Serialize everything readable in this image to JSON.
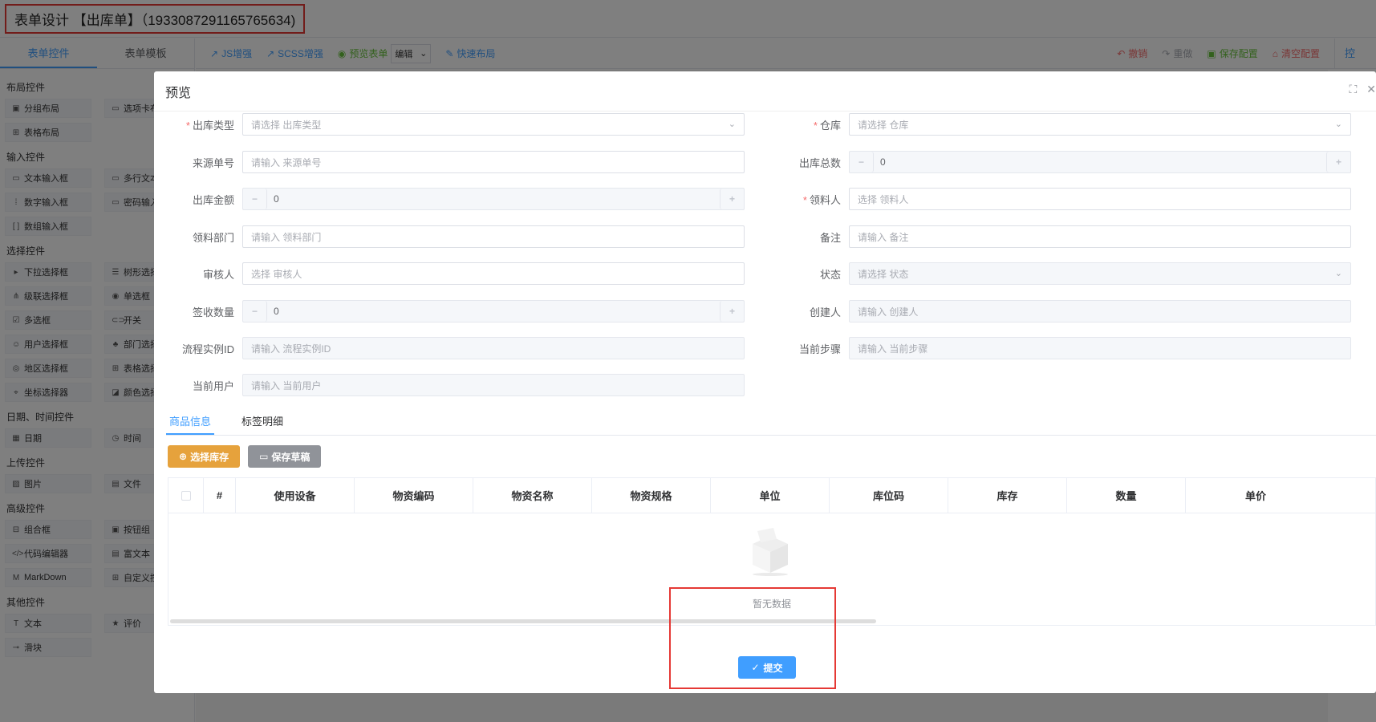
{
  "app": {
    "title": "表单设计 【出库单】（1933087291165765634)"
  },
  "left_panel": {
    "tabs": [
      "表单控件",
      "表单模板"
    ],
    "groups": [
      {
        "title": "布局控件",
        "items": [
          {
            "icon": "▣",
            "label": "分组布局"
          },
          {
            "icon": "▭",
            "label": "选项卡布"
          },
          {
            "icon": "⊞",
            "label": "表格布局"
          }
        ]
      },
      {
        "title": "输入控件",
        "items": [
          {
            "icon": "▭",
            "label": "文本输入框"
          },
          {
            "icon": "▭",
            "label": "多行文本"
          },
          {
            "icon": "⁞",
            "label": "数字输入框"
          },
          {
            "icon": "▭",
            "label": "密码输入"
          },
          {
            "icon": "[ ]",
            "label": "数组输入框"
          }
        ]
      },
      {
        "title": "选择控件",
        "items": [
          {
            "icon": "▸",
            "label": "下拉选择框"
          },
          {
            "icon": "☰",
            "label": "树形选择"
          },
          {
            "icon": "⋔",
            "label": "级联选择框"
          },
          {
            "icon": "◉",
            "label": "单选框"
          },
          {
            "icon": "☑",
            "label": "多选框"
          },
          {
            "icon": "⊂⊃",
            "label": "开关"
          },
          {
            "icon": "☺",
            "label": "用户选择框"
          },
          {
            "icon": "♣",
            "label": "部门选择"
          },
          {
            "icon": "◎",
            "label": "地区选择框"
          },
          {
            "icon": "⊞",
            "label": "表格选择"
          },
          {
            "icon": "⌖",
            "label": "坐标选择器"
          },
          {
            "icon": "◪",
            "label": "颜色选择"
          }
        ]
      },
      {
        "title": "日期、时间控件",
        "items": [
          {
            "icon": "▦",
            "label": "日期"
          },
          {
            "icon": "◷",
            "label": "时间"
          }
        ]
      },
      {
        "title": "上传控件",
        "items": [
          {
            "icon": "▨",
            "label": "图片"
          },
          {
            "icon": "▤",
            "label": "文件"
          }
        ]
      },
      {
        "title": "高级控件",
        "items": [
          {
            "icon": "⊟",
            "label": "组合框"
          },
          {
            "icon": "▣",
            "label": "按钮组"
          },
          {
            "icon": "</>",
            "label": "代码编辑器"
          },
          {
            "icon": "▤",
            "label": "富文本"
          },
          {
            "icon": "M",
            "label": "MarkDown"
          },
          {
            "icon": "⊞",
            "label": "自定义控"
          }
        ]
      },
      {
        "title": "其他控件",
        "items": [
          {
            "icon": "T",
            "label": "文本"
          },
          {
            "icon": "★",
            "label": "评价"
          },
          {
            "icon": "⊸",
            "label": "滑块"
          }
        ]
      }
    ]
  },
  "toolbar": {
    "js": "JS增强",
    "scss": "SCSS增强",
    "preview": "预览表单",
    "mode": "编辑",
    "quick_layout": "快速布局",
    "undo": "撤销",
    "redo": "重做",
    "save": "保存配置",
    "clear": "清空配置",
    "right_tab": "控"
  },
  "modal": {
    "title": "预览",
    "form": {
      "out_type_label": "出库类型",
      "out_type_ph": "请选择 出库类型",
      "warehouse_label": "仓库",
      "warehouse_ph": "请选择 仓库",
      "source_no_label": "来源单号",
      "source_no_ph": "请输入 来源单号",
      "total_qty_label": "出库总数",
      "total_qty_val": "0",
      "amount_label": "出库金额",
      "amount_val": "0",
      "receiver_label": "领料人",
      "receiver_ph": "选择 领料人",
      "dept_label": "领料部门",
      "dept_ph": "请输入 领料部门",
      "remark_label": "备注",
      "remark_ph": "请输入 备注",
      "auditor_label": "审核人",
      "auditor_ph": "选择 审核人",
      "status_label": "状态",
      "status_ph": "请选择 状态",
      "sign_qty_label": "签收数量",
      "sign_qty_val": "0",
      "creator_label": "创建人",
      "creator_ph": "请输入 创建人",
      "flow_id_label": "流程实例ID",
      "flow_id_ph": "请输入 流程实例ID",
      "step_label": "当前步骤",
      "step_ph": "请输入 当前步骤",
      "user_label": "当前用户",
      "user_ph": "请输入 当前用户"
    },
    "tabs": [
      "商品信息",
      "标签明细"
    ],
    "buttons": {
      "select_stock": "选择库存",
      "save_draft": "保存草稿"
    },
    "table": {
      "columns": [
        "#",
        "使用设备",
        "物资编码",
        "物资名称",
        "物资规格",
        "单位",
        "库位码",
        "库存",
        "数量",
        "单价"
      ],
      "empty_text": "暂无数据"
    },
    "submit": "提交"
  },
  "colors": {
    "primary": "#409eff",
    "warning": "#e6a23c",
    "info": "#909399",
    "danger": "#e53935"
  }
}
